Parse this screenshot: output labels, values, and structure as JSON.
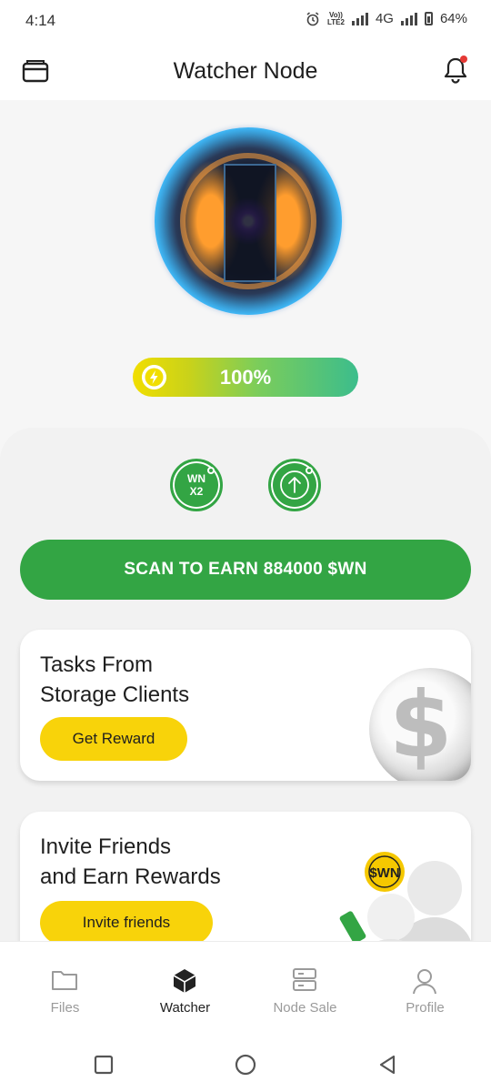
{
  "status_bar": {
    "time": "4:14",
    "volte_line1": "Vo))",
    "volte_line2": "LTE2",
    "network": "4G",
    "battery": "64%"
  },
  "header": {
    "title": "Watcher Node",
    "left_icon": "wallet-icon",
    "right_icon": "bell-icon",
    "notification_dot_color": "#e53935"
  },
  "energy": {
    "percent_label": "100%",
    "level": 1.0,
    "icon": "bolt-icon"
  },
  "actions": {
    "multiplier_label": "WN\nX2",
    "boost_icon": "arrow-up-icon",
    "scan_label": "SCAN TO EARN 884000 $WN",
    "accent": "#33a544"
  },
  "cards": {
    "tasks": {
      "title_line1": "Tasks From",
      "title_line2": "Storage Clients",
      "button_label": "Get Reward",
      "art": "silver-dollar-coin"
    },
    "invite": {
      "title_line1": "Invite Friends",
      "title_line2": "and Earn Rewards",
      "button_label": "Invite friends",
      "art": "people-with-wn-coin",
      "coin_text": "$WN"
    }
  },
  "bottom_nav": {
    "items": [
      {
        "label": "Files",
        "icon": "folder-icon",
        "active": false
      },
      {
        "label": "Watcher",
        "icon": "cube-icon",
        "active": true
      },
      {
        "label": "Node Sale",
        "icon": "server-icon",
        "active": false
      },
      {
        "label": "Profile",
        "icon": "user-icon",
        "active": false
      }
    ]
  }
}
